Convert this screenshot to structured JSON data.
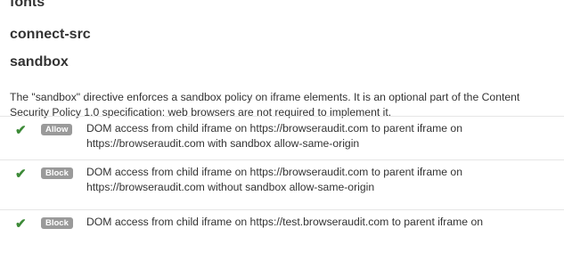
{
  "headings": {
    "fonts": "fonts",
    "connect_src": "connect-src",
    "sandbox": "sandbox"
  },
  "sandbox_description": "The \"sandbox\" directive enforces a sandbox policy on iframe elements. It is an optional part of the Content Security Policy 1.0 specification: web browsers are not required to implement it.",
  "tests": [
    {
      "status_icon": "check-icon",
      "badge": "Allow",
      "text": "DOM access from child iframe on https://browseraudit.com to parent iframe on https://browseraudit.com with sandbox allow-same-origin"
    },
    {
      "status_icon": "check-icon",
      "badge": "Block",
      "text": "DOM access from child iframe on https://browseraudit.com to parent iframe on https://browseraudit.com without sandbox allow-same-origin"
    },
    {
      "status_icon": "check-icon",
      "badge": "Block",
      "text": "DOM access from child iframe on https://test.browseraudit.com to parent iframe on"
    }
  ],
  "colors": {
    "check": "#3c8a37",
    "badge_bg": "#9a9a9a",
    "text": "#333333"
  }
}
